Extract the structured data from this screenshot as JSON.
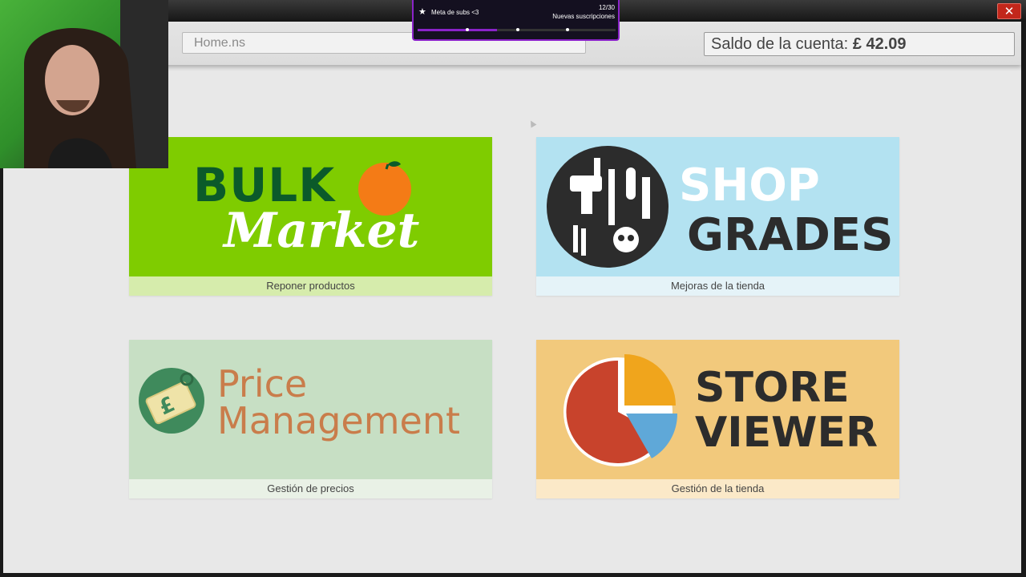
{
  "window": {
    "address": "Home.ns",
    "balance_label": "Saldo de la cuenta:",
    "balance_value": "£ 42.09",
    "close_glyph": "✕"
  },
  "cards": [
    {
      "id": "bulk-market",
      "title_line1": "BULK",
      "title_line2": "Market",
      "caption": "Reponer productos",
      "icon": "orange-icon",
      "accent": "#7fcc00"
    },
    {
      "id": "shop-grades",
      "title_line1": "SHOP",
      "title_line2": "GRADES",
      "caption": "Mejoras de la tienda",
      "icon": "tools-icon",
      "accent": "#b3e2f1"
    },
    {
      "id": "price-management",
      "title_line1": "Price",
      "title_line2": "Management",
      "caption": "Gestión de precios",
      "icon": "price-tag-icon",
      "accent": "#c7dfc4"
    },
    {
      "id": "store-viewer",
      "title_line1": "STORE",
      "title_line2": "VIEWER",
      "caption": "Gestión de la tienda",
      "icon": "pie-chart-icon",
      "accent": "#f2c97c"
    }
  ],
  "stream_overlay": {
    "goal_label": "Meta de subs <3",
    "count": "12/30",
    "subtitle": "Nuevas suscripciones",
    "progress": 0.4
  }
}
